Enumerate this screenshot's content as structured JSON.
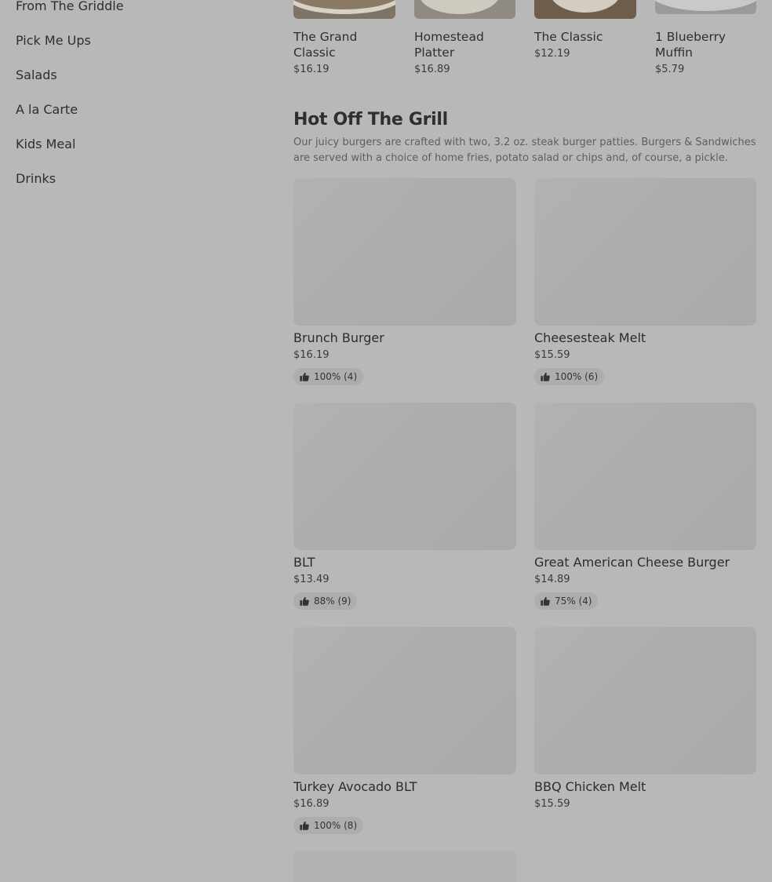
{
  "sidebar": {
    "items": [
      {
        "label": "From The Griddle"
      },
      {
        "label": "Pick Me Ups"
      },
      {
        "label": "Salads"
      },
      {
        "label": "A la Carte"
      },
      {
        "label": "Kids Meal"
      },
      {
        "label": "Drinks"
      }
    ]
  },
  "top_row": [
    {
      "name": "The Grand Classic",
      "price": "$16.19"
    },
    {
      "name": "Homestead Platter",
      "price": "$16.89"
    },
    {
      "name": "The Classic",
      "price": "$12.19"
    },
    {
      "name": "1 Blueberry Muffin",
      "price": "$5.79"
    }
  ],
  "section": {
    "title": "Hot Off The Grill",
    "description": "Our juicy burgers are crafted with two, 3.2 oz. steak burger patties. Burgers & Sandwiches are served with a choice of home fries, potato salad or chips and, of course, a pickle."
  },
  "cards": [
    {
      "name": "Brunch Burger",
      "price": "$16.19",
      "rating": "100% (4)"
    },
    {
      "name": "Cheesesteak Melt",
      "price": "$15.59",
      "rating": "100% (6)"
    },
    {
      "name": "BLT",
      "price": "$13.49",
      "rating": "88% (9)"
    },
    {
      "name": "Great American Cheese Burger",
      "price": "$14.89",
      "rating": "75% (4)"
    },
    {
      "name": "Turkey Avocado BLT",
      "price": "$16.89",
      "rating": "100% (8)"
    },
    {
      "name": "BBQ Chicken Melt",
      "price": "$15.59",
      "rating": null
    }
  ],
  "icons": {
    "rating": "thumbs-up-icon"
  }
}
